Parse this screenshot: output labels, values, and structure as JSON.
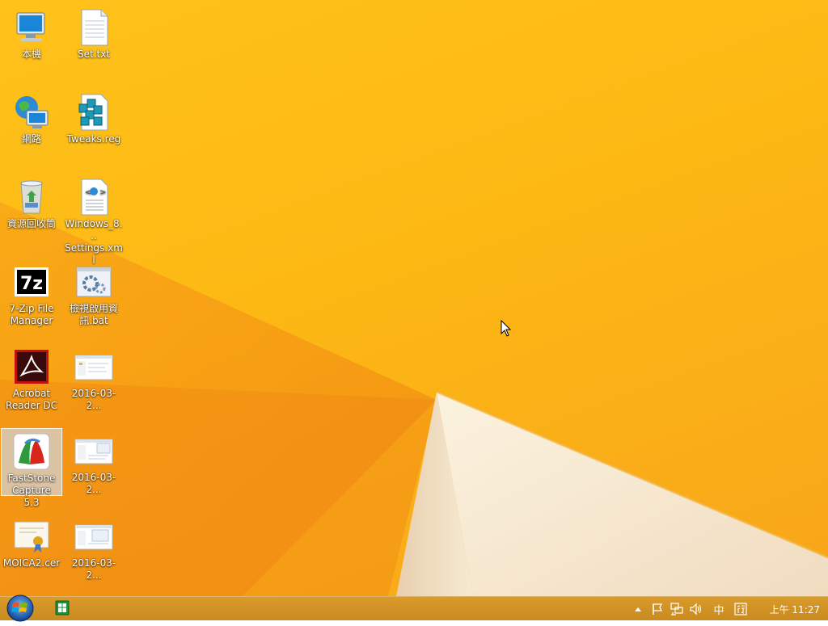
{
  "desktop": {
    "icons": [
      {
        "label": "本機",
        "glyph": "computer-icon"
      },
      {
        "label": "Set.txt",
        "glyph": "text-file-icon"
      },
      {
        "label": "網路",
        "glyph": "network-icon"
      },
      {
        "label": "Tweaks.reg",
        "glyph": "registry-file-icon"
      },
      {
        "label": "資源回收筒",
        "glyph": "recycle-bin-icon"
      },
      {
        "label": "Windows_8...\nSettings.xml",
        "glyph": "xml-file-icon"
      },
      {
        "label": "7-Zip File\nManager",
        "glyph": "7zip-icon"
      },
      {
        "label": "檢視啟用資\n訊.bat",
        "glyph": "batch-file-icon"
      },
      {
        "label": "Acrobat\nReader DC",
        "glyph": "acrobat-icon"
      },
      {
        "label": "2016-03-2...",
        "glyph": "image-file-icon"
      },
      {
        "label": "FastStone\nCapture 5.3",
        "glyph": "faststone-icon"
      },
      {
        "label": "2016-03-2...",
        "glyph": "image-file-icon"
      },
      {
        "label": "MOICA2.cer",
        "glyph": "certificate-icon"
      },
      {
        "label": "2016-03-2...",
        "glyph": "image-file-icon"
      }
    ]
  },
  "taskbar": {
    "ime_label": "中",
    "clock": "上午 11:27"
  },
  "colors": {
    "wallpaper": "#fdb814",
    "taskbar": "#d0921f"
  }
}
